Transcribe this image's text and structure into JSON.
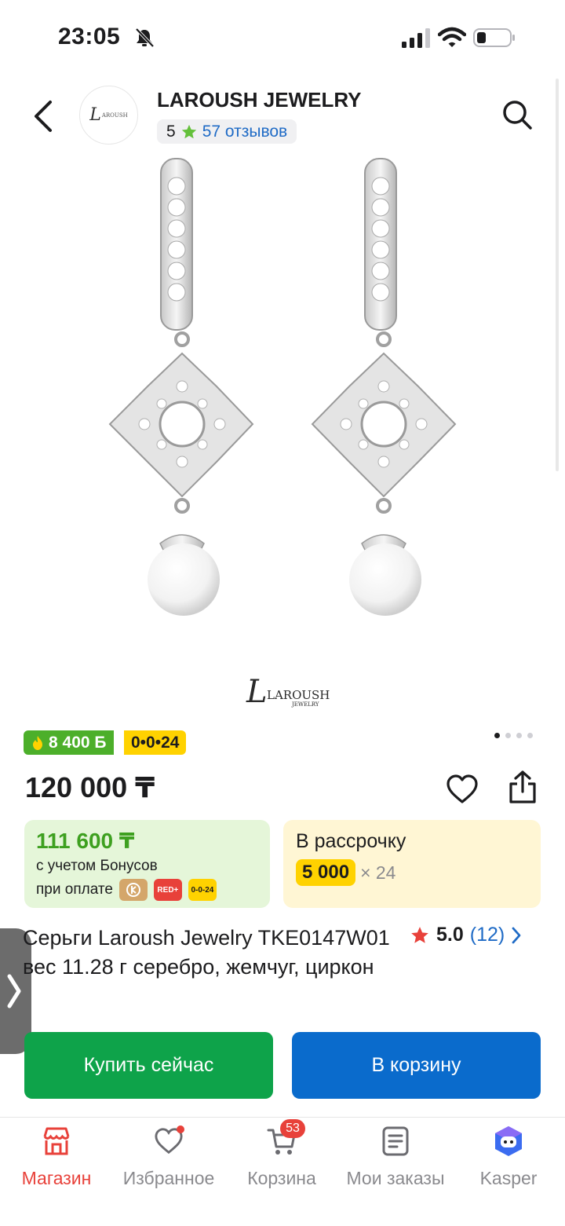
{
  "status_bar": {
    "time": "23:05"
  },
  "header": {
    "store_name": "LAROUSH JEWELRY",
    "store_logo_text": "L",
    "store_logo_sub": "AROUSH",
    "rating": "5",
    "reviews": "57 отзывов"
  },
  "gallery": {
    "brand_mark": "LAROUSH",
    "brand_sub": "JEWELRY",
    "dots_count": 4,
    "active_dot": 0
  },
  "promo": {
    "bonus_badge": "8 400 Б",
    "installment_badge": "0•0•24"
  },
  "price": "120 000 ₸",
  "bonus_card": {
    "amount": "111 600 ₸",
    "line1": "с учетом Бонусов",
    "line2": "при оплате",
    "chips": [
      "RED+",
      "0-0-24"
    ]
  },
  "installment_card": {
    "title": "В рассрочку",
    "amount": "5 000",
    "multiplier": "× 24"
  },
  "product": {
    "title": "Серьги Laroush Jewelry TKE0147W01 вес 11.28 г серебро, жемчуг, циркон",
    "rating": "5.0",
    "reviews_count": "(12)"
  },
  "buttons": {
    "buy_now": "Купить сейчас",
    "add_to_cart": "В корзину"
  },
  "bottom_nav": {
    "items": [
      {
        "label": "Магазин",
        "icon": "store-icon",
        "active": true
      },
      {
        "label": "Избранное",
        "icon": "heart-icon",
        "active": false
      },
      {
        "label": "Корзина",
        "icon": "cart-icon",
        "active": false,
        "badge": "53"
      },
      {
        "label": "Мои заказы",
        "icon": "orders-icon",
        "active": false
      },
      {
        "label": "Kasper",
        "icon": "kasper-icon",
        "active": false
      }
    ]
  },
  "colors": {
    "accent_red": "#e8413a",
    "link_blue": "#1f6bc6",
    "buy_green": "#0ea34a",
    "cart_blue": "#0a6bcc",
    "bonus_green": "#4caf2a",
    "installment_yellow": "#ffd200"
  }
}
